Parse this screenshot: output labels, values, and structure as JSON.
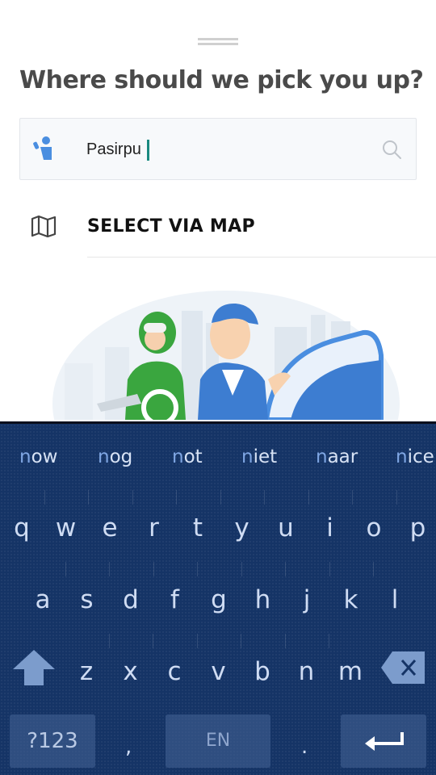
{
  "sheet": {
    "title": "Where should we pick you up?",
    "search": {
      "value": "Pasirpu",
      "pin_icon": "pickup-person-pin-icon",
      "search_icon": "search-icon"
    },
    "select_via_map": {
      "label": "SELECT VIA MAP",
      "icon": "map-icon"
    }
  },
  "colors": {
    "accent_blue": "#4a8ee0",
    "keyboard_bg": "#153466",
    "caret": "#1a8a80",
    "brand_green": "#3aa63f"
  },
  "keyboard": {
    "suggestions": [
      {
        "typed": "n",
        "rest": "ow"
      },
      {
        "typed": "n",
        "rest": "og"
      },
      {
        "typed": "n",
        "rest": "ot"
      },
      {
        "typed": "n",
        "rest": "iet"
      },
      {
        "typed": "n",
        "rest": "aar"
      },
      {
        "typed": "n",
        "rest": "ice"
      }
    ],
    "row1": [
      "q",
      "w",
      "e",
      "r",
      "t",
      "y",
      "u",
      "i",
      "o",
      "p"
    ],
    "row2": [
      "a",
      "s",
      "d",
      "f",
      "g",
      "h",
      "j",
      "k",
      "l"
    ],
    "row3": [
      "z",
      "x",
      "c",
      "v",
      "b",
      "n",
      "m"
    ],
    "symbols_label": "?123",
    "space_label": "EN",
    "comma": ",",
    "period": ".",
    "shift_icon": "shift-arrow-icon",
    "backspace_icon": "backspace-icon",
    "enter_icon": "enter-arrow-icon"
  }
}
